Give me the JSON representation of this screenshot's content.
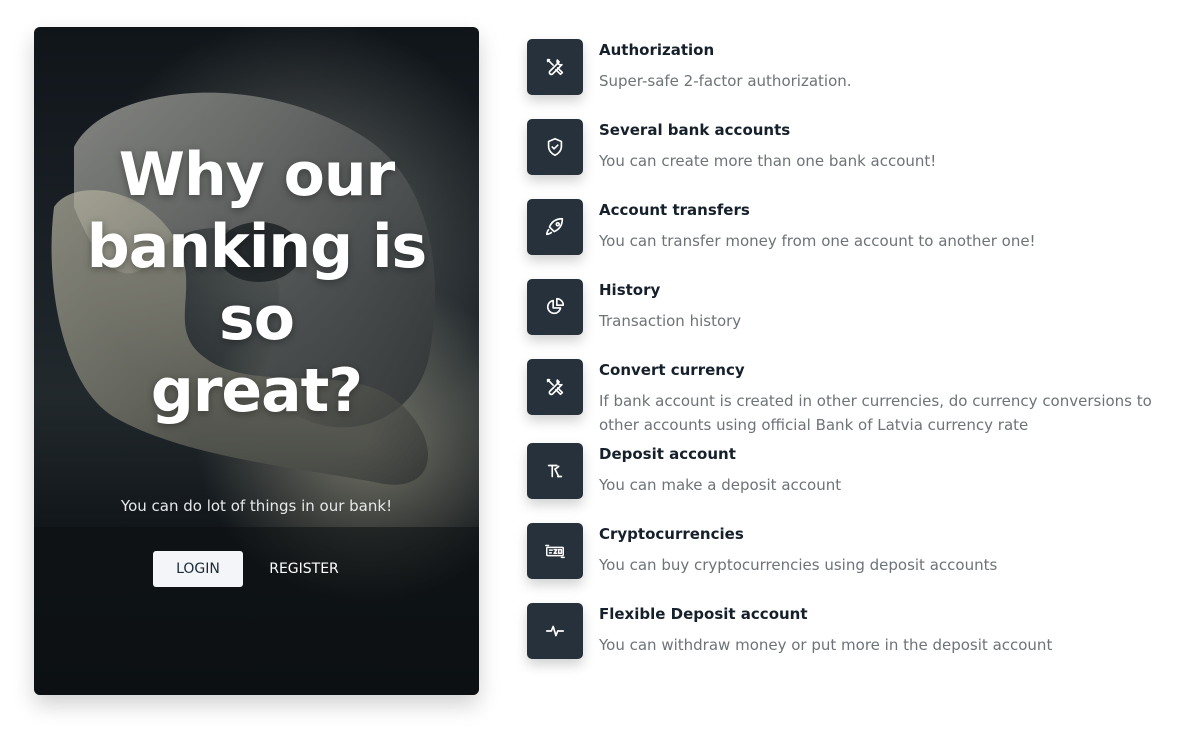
{
  "hero": {
    "title_lines": [
      "Why our",
      "banking is",
      "so",
      "great?"
    ],
    "subtitle": "You can do lot of things in our bank!",
    "login_label": "LOGIN",
    "register_label": "REGISTER"
  },
  "features": [
    {
      "icon": "tools-icon",
      "title": "Authorization",
      "description": "Super-safe 2-factor authorization."
    },
    {
      "icon": "shield-check-icon",
      "title": "Several bank accounts",
      "description": "You can create more than one bank account!"
    },
    {
      "icon": "rocket-icon",
      "title": "Account transfers",
      "description": "You can transfer money from one account to another one!"
    },
    {
      "icon": "pie-chart-icon",
      "title": "History",
      "description": "Transaction history"
    },
    {
      "icon": "tools-icon",
      "title": "Convert currency",
      "description": "If bank account is created in other currencies, do currency conversions to other accounts using official Bank of Latvia currency rate"
    },
    {
      "icon": "deposit-icon",
      "title": "Deposit account",
      "description": "You can make a deposit account"
    },
    {
      "icon": "crypto-icon",
      "title": "Cryptocurrencies",
      "description": "You can buy cryptocurrencies using deposit accounts"
    },
    {
      "icon": "pulse-icon",
      "title": "Flexible Deposit account",
      "description": "You can withdraw money or put more in the deposit account"
    }
  ],
  "colors": {
    "icon_box": "#26313b",
    "title": "#15202b",
    "description": "#6e7378"
  }
}
